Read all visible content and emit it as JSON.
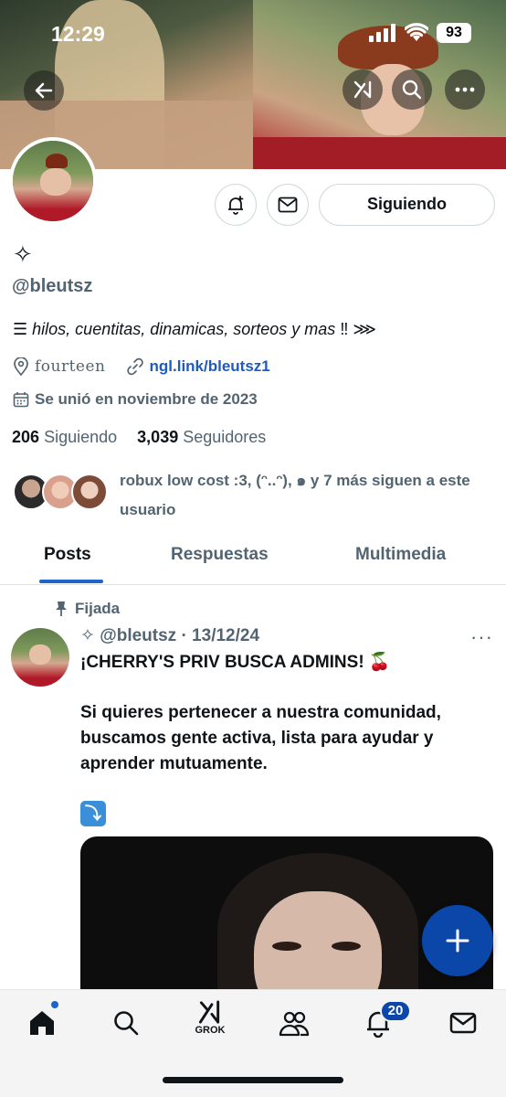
{
  "status_bar": {
    "time": "12:29",
    "battery": "93"
  },
  "profile": {
    "display_name": "✧",
    "handle": "@bleutsz",
    "bio_prefix": "☰",
    "bio_text": "hilos, cuentitas, dinamicas, sorteos y mas",
    "bio_suffix": "‼ ⋙",
    "location": "fourteen",
    "link": "ngl.link/bleutsz1",
    "joined": "Se unió en noviembre de 2023",
    "following_count": "206",
    "following_label": "Siguiendo",
    "followers_count": "3,039",
    "followers_label": "Seguidores",
    "known_followers_text": "robux low cost :3, (ᵔ..ᵔ), ๑ y 7 más siguen a este usuario",
    "follow_button_label": "Siguiendo"
  },
  "tabs": [
    {
      "label": "Posts",
      "active": true
    },
    {
      "label": "Respuestas",
      "active": false
    },
    {
      "label": "Multimedia",
      "active": false
    }
  ],
  "pinned_post": {
    "pinned_label": "Fijada",
    "header": "✧ @bleutsz · 13/12/24",
    "more": "···",
    "title": "¡CHERRY'S PRIV BUSCA ADMINS! 🍒",
    "body": "Si quieres pertenecer a nuestra comunidad, buscamos gente activa, lista para ayudar y aprender mutuamente.",
    "emoji": "⤵"
  },
  "bottom_nav": {
    "grok_label": "GROK",
    "notif_badge": "20"
  },
  "colors": {
    "accent": "#1d66c9",
    "fab": "#0a47a9",
    "link": "#1d5bbf",
    "muted": "#536471"
  }
}
